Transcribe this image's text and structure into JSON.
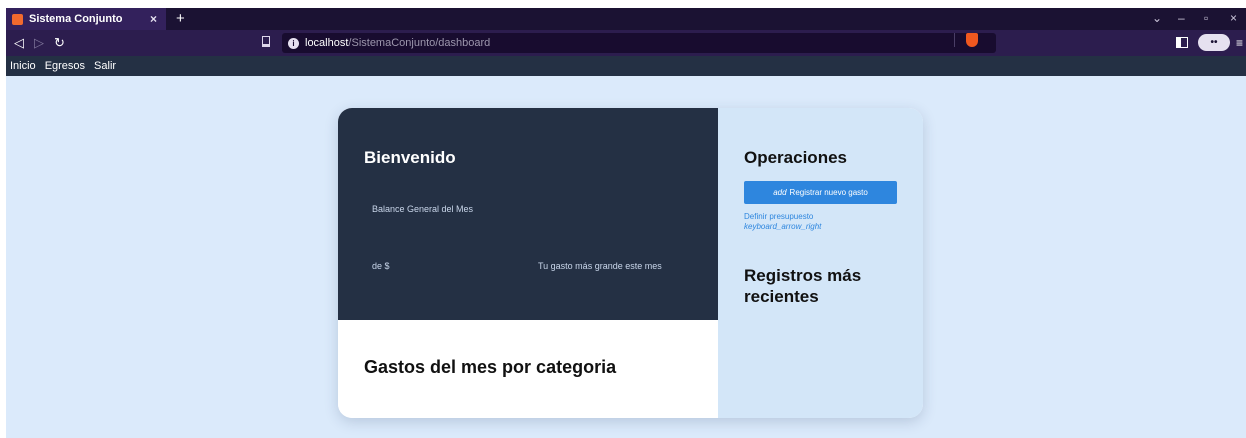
{
  "browser": {
    "tab_title": "Sistema Conjunto",
    "tab_close": "×",
    "new_tab": "+",
    "url_host": "localhost",
    "url_path": "/SistemaConjunto/dashboard",
    "wallet_glyph": "••",
    "controls": {
      "dropdown": "⌄",
      "minimize": "–",
      "restore": "▫",
      "close": "×",
      "back": "◁",
      "forward": "▷",
      "reload": "↻",
      "menu": "≡"
    },
    "accent_color": "#f0581f"
  },
  "nav": {
    "items": [
      {
        "label": "Inicio"
      },
      {
        "label": "Egresos"
      },
      {
        "label": "Salir"
      }
    ]
  },
  "dashboard": {
    "welcome_title": "Bienvenido",
    "balance_label": "Balance General del Mes",
    "currency_label": "de $",
    "biggest_expense_label": "Tu gasto más grande este mes",
    "category_chart_title": "Gastos del mes por categoria"
  },
  "operations": {
    "title": "Operaciones",
    "add_button_icon": "add",
    "add_button_label": "Registrar nuevo gasto",
    "budget_link_label": "Definir presupuesto",
    "budget_link_icon": "keyboard_arrow_right",
    "recent_title": "Registros más recientes"
  },
  "colors": {
    "page_background": "#dbeafb",
    "dark_panel": "#243044",
    "side_panel": "#d3e6f8",
    "primary_button": "#2e86de"
  }
}
